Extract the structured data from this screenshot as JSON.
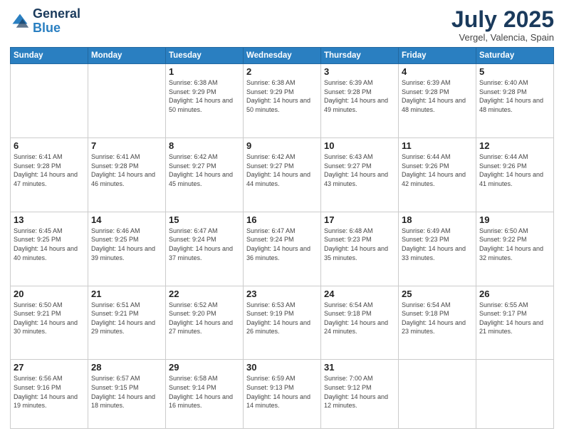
{
  "header": {
    "logo": {
      "general": "General",
      "blue": "Blue"
    },
    "month": "July 2025",
    "location": "Vergel, Valencia, Spain"
  },
  "weekdays": [
    "Sunday",
    "Monday",
    "Tuesday",
    "Wednesday",
    "Thursday",
    "Friday",
    "Saturday"
  ],
  "rows": [
    [
      {
        "day": "",
        "info": ""
      },
      {
        "day": "",
        "info": ""
      },
      {
        "day": "1",
        "info": "Sunrise: 6:38 AM\nSunset: 9:29 PM\nDaylight: 14 hours and 50 minutes."
      },
      {
        "day": "2",
        "info": "Sunrise: 6:38 AM\nSunset: 9:29 PM\nDaylight: 14 hours and 50 minutes."
      },
      {
        "day": "3",
        "info": "Sunrise: 6:39 AM\nSunset: 9:28 PM\nDaylight: 14 hours and 49 minutes."
      },
      {
        "day": "4",
        "info": "Sunrise: 6:39 AM\nSunset: 9:28 PM\nDaylight: 14 hours and 48 minutes."
      },
      {
        "day": "5",
        "info": "Sunrise: 6:40 AM\nSunset: 9:28 PM\nDaylight: 14 hours and 48 minutes."
      }
    ],
    [
      {
        "day": "6",
        "info": "Sunrise: 6:41 AM\nSunset: 9:28 PM\nDaylight: 14 hours and 47 minutes."
      },
      {
        "day": "7",
        "info": "Sunrise: 6:41 AM\nSunset: 9:28 PM\nDaylight: 14 hours and 46 minutes."
      },
      {
        "day": "8",
        "info": "Sunrise: 6:42 AM\nSunset: 9:27 PM\nDaylight: 14 hours and 45 minutes."
      },
      {
        "day": "9",
        "info": "Sunrise: 6:42 AM\nSunset: 9:27 PM\nDaylight: 14 hours and 44 minutes."
      },
      {
        "day": "10",
        "info": "Sunrise: 6:43 AM\nSunset: 9:27 PM\nDaylight: 14 hours and 43 minutes."
      },
      {
        "day": "11",
        "info": "Sunrise: 6:44 AM\nSunset: 9:26 PM\nDaylight: 14 hours and 42 minutes."
      },
      {
        "day": "12",
        "info": "Sunrise: 6:44 AM\nSunset: 9:26 PM\nDaylight: 14 hours and 41 minutes."
      }
    ],
    [
      {
        "day": "13",
        "info": "Sunrise: 6:45 AM\nSunset: 9:25 PM\nDaylight: 14 hours and 40 minutes."
      },
      {
        "day": "14",
        "info": "Sunrise: 6:46 AM\nSunset: 9:25 PM\nDaylight: 14 hours and 39 minutes."
      },
      {
        "day": "15",
        "info": "Sunrise: 6:47 AM\nSunset: 9:24 PM\nDaylight: 14 hours and 37 minutes."
      },
      {
        "day": "16",
        "info": "Sunrise: 6:47 AM\nSunset: 9:24 PM\nDaylight: 14 hours and 36 minutes."
      },
      {
        "day": "17",
        "info": "Sunrise: 6:48 AM\nSunset: 9:23 PM\nDaylight: 14 hours and 35 minutes."
      },
      {
        "day": "18",
        "info": "Sunrise: 6:49 AM\nSunset: 9:23 PM\nDaylight: 14 hours and 33 minutes."
      },
      {
        "day": "19",
        "info": "Sunrise: 6:50 AM\nSunset: 9:22 PM\nDaylight: 14 hours and 32 minutes."
      }
    ],
    [
      {
        "day": "20",
        "info": "Sunrise: 6:50 AM\nSunset: 9:21 PM\nDaylight: 14 hours and 30 minutes."
      },
      {
        "day": "21",
        "info": "Sunrise: 6:51 AM\nSunset: 9:21 PM\nDaylight: 14 hours and 29 minutes."
      },
      {
        "day": "22",
        "info": "Sunrise: 6:52 AM\nSunset: 9:20 PM\nDaylight: 14 hours and 27 minutes."
      },
      {
        "day": "23",
        "info": "Sunrise: 6:53 AM\nSunset: 9:19 PM\nDaylight: 14 hours and 26 minutes."
      },
      {
        "day": "24",
        "info": "Sunrise: 6:54 AM\nSunset: 9:18 PM\nDaylight: 14 hours and 24 minutes."
      },
      {
        "day": "25",
        "info": "Sunrise: 6:54 AM\nSunset: 9:18 PM\nDaylight: 14 hours and 23 minutes."
      },
      {
        "day": "26",
        "info": "Sunrise: 6:55 AM\nSunset: 9:17 PM\nDaylight: 14 hours and 21 minutes."
      }
    ],
    [
      {
        "day": "27",
        "info": "Sunrise: 6:56 AM\nSunset: 9:16 PM\nDaylight: 14 hours and 19 minutes."
      },
      {
        "day": "28",
        "info": "Sunrise: 6:57 AM\nSunset: 9:15 PM\nDaylight: 14 hours and 18 minutes."
      },
      {
        "day": "29",
        "info": "Sunrise: 6:58 AM\nSunset: 9:14 PM\nDaylight: 14 hours and 16 minutes."
      },
      {
        "day": "30",
        "info": "Sunrise: 6:59 AM\nSunset: 9:13 PM\nDaylight: 14 hours and 14 minutes."
      },
      {
        "day": "31",
        "info": "Sunrise: 7:00 AM\nSunset: 9:12 PM\nDaylight: 14 hours and 12 minutes."
      },
      {
        "day": "",
        "info": ""
      },
      {
        "day": "",
        "info": ""
      }
    ]
  ]
}
